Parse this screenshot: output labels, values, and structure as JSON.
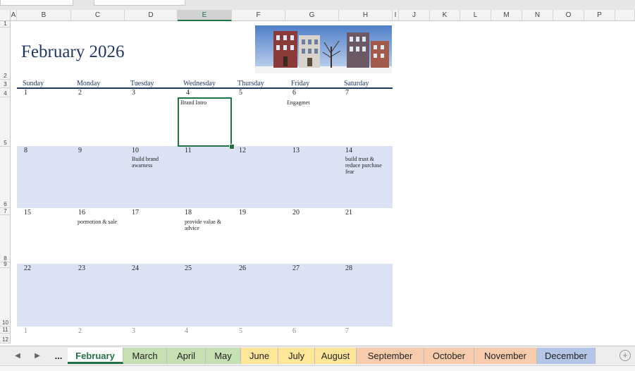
{
  "sheet": {
    "title": "February 2026",
    "columns": [
      "A",
      "B",
      "C",
      "D",
      "E",
      "F",
      "G",
      "H",
      "I",
      "J",
      "K",
      "L",
      "M",
      "N",
      "O",
      "P"
    ],
    "rows": [
      "1",
      "2",
      "3",
      "4",
      "5",
      "6",
      "7",
      "8",
      "9",
      "10",
      "11",
      "12"
    ],
    "day_names": [
      "Sunday",
      "Monday",
      "Tuesday",
      "Wednesday",
      "Thursday",
      "Friday",
      "Saturday"
    ],
    "weeks": [
      {
        "days": [
          "1",
          "2",
          "3",
          "4",
          "5",
          "6",
          "7"
        ],
        "notes": [
          "",
          "",
          "",
          "Brand Intro",
          "",
          "Engagmet",
          ""
        ]
      },
      {
        "days": [
          "8",
          "9",
          "10",
          "11",
          "12",
          "13",
          "14"
        ],
        "notes": [
          "",
          "",
          "Build brand awarness",
          "",
          "",
          "",
          "build trust & reduce purchase fear"
        ]
      },
      {
        "days": [
          "15",
          "16",
          "17",
          "18",
          "19",
          "20",
          "21"
        ],
        "notes": [
          "",
          "pormotion & sale",
          "",
          "provide value & advice",
          "",
          "",
          ""
        ]
      },
      {
        "days": [
          "22",
          "23",
          "24",
          "25",
          "26",
          "27",
          "28"
        ],
        "notes": [
          "",
          "",
          "",
          "",
          "",
          "",
          ""
        ]
      },
      {
        "days": [
          "1",
          "2",
          "3",
          "4",
          "5",
          "6",
          "7"
        ],
        "notes": [
          "",
          "",
          "",
          "",
          "",
          "",
          ""
        ]
      }
    ]
  },
  "tabs": {
    "more": "...",
    "add": "+",
    "items": [
      {
        "label": "February",
        "color": "#ffffff",
        "active": true
      },
      {
        "label": "March",
        "color": "#c6e0b4"
      },
      {
        "label": "April",
        "color": "#c6e0b4"
      },
      {
        "label": "May",
        "color": "#c6e0b4"
      },
      {
        "label": "June",
        "color": "#ffe699"
      },
      {
        "label": "July",
        "color": "#ffe699"
      },
      {
        "label": "August",
        "color": "#ffe699"
      },
      {
        "label": "September",
        "color": "#f8cbad"
      },
      {
        "label": "October",
        "color": "#f8cbad"
      },
      {
        "label": "November",
        "color": "#f8cbad"
      },
      {
        "label": "December",
        "color": "#b4c6e7"
      }
    ]
  },
  "colors": {
    "accent": "#217346",
    "calendar_blue": "#1f3864",
    "band": "#dae2f3"
  }
}
